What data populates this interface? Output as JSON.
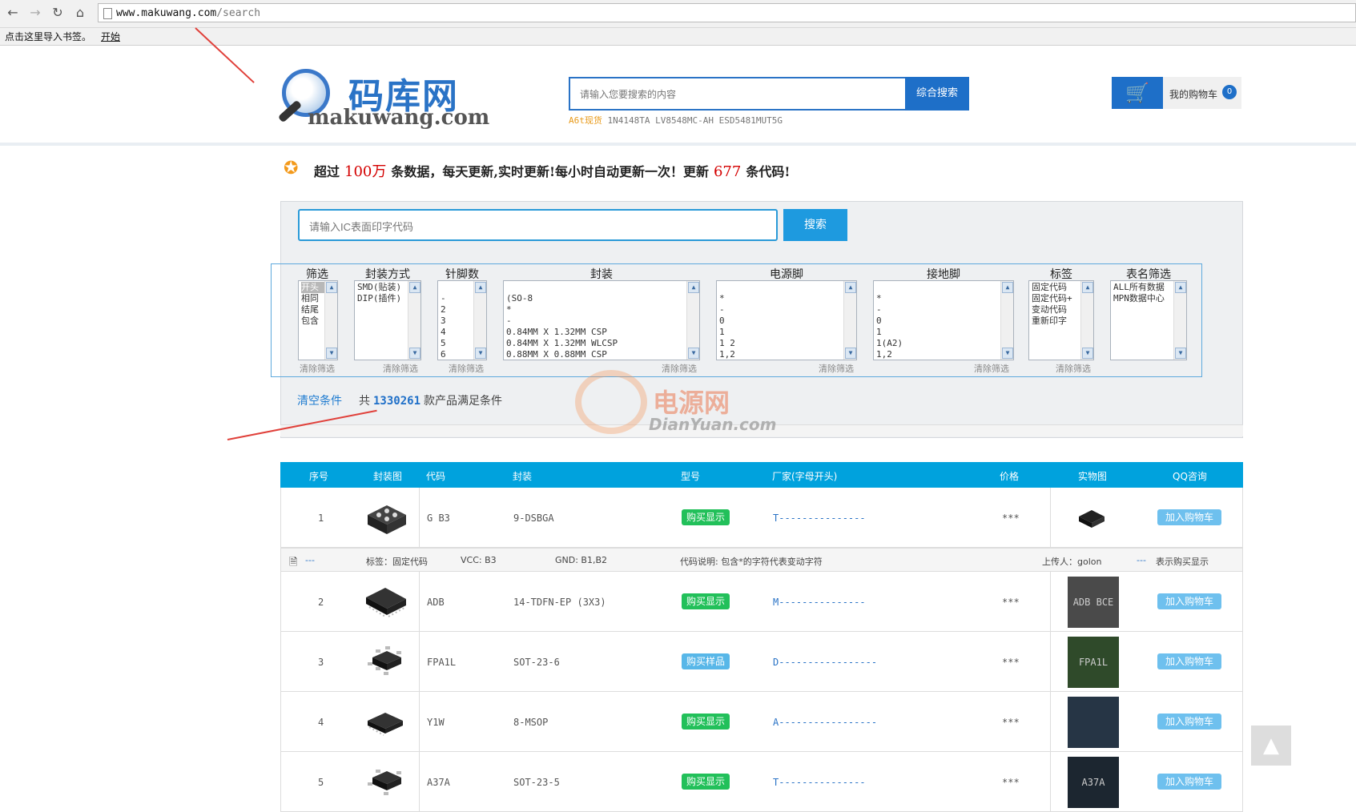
{
  "browser": {
    "url_host": "www.makuwang.com",
    "url_path": "/search",
    "bookmark_hint": "点击这里导入书签。",
    "bookmark_link": "开始"
  },
  "header": {
    "logo_cn": "码库网",
    "logo_en": "makuwang.com",
    "search_placeholder": "请输入您要搜索的内容",
    "search_button": "综合搜索",
    "hot_label": "A6t现货",
    "hot_items": "1N4148TA  LV8548MC-AH  ESD5481MUT5G",
    "cart_label": "我的购物车",
    "cart_count": "0"
  },
  "announce": {
    "p1": "超过",
    "num1": "100万",
    "p2": "条数据，每天更新,实时更新!每小时自动更新一次！更新",
    "num2": "677",
    "p3": "条代码!"
  },
  "filter": {
    "ic_placeholder": "请输入IC表面印字代码",
    "ic_button": "搜索",
    "clear_label": "清除筛选",
    "columns": [
      {
        "title": "筛选",
        "items": [
          "开头",
          "相同",
          "结尾",
          "包含"
        ]
      },
      {
        "title": "封装方式",
        "items": [
          "SMD(贴装)",
          "DIP(插件)"
        ]
      },
      {
        "title": "针脚数",
        "items": [
          "",
          "-",
          "2",
          "3",
          "4",
          "5",
          "6"
        ]
      },
      {
        "title": "封装",
        "items": [
          "",
          "(SO-8",
          "*",
          "-",
          "0.84MM X 1.32MM CSP",
          "0.84MM X 1.32MM WLCSP",
          "0.88MM X 0.88MM CSP"
        ]
      },
      {
        "title": "电源脚",
        "items": [
          "",
          "*",
          "-",
          "0",
          "1",
          "1 2",
          "1,2"
        ]
      },
      {
        "title": "接地脚",
        "items": [
          "",
          "*",
          "-",
          "0",
          "1",
          "1(A2)",
          "1,2"
        ]
      },
      {
        "title": "标签",
        "items": [
          "固定代码",
          "固定代码+",
          "变动代码",
          "重新印字"
        ]
      },
      {
        "title": "表名筛选",
        "items": [
          "ALL所有数据",
          "MPN数据中心"
        ]
      }
    ],
    "clear_all": "清空条件",
    "count_prefix": "共",
    "count_value": "1330261",
    "count_suffix": "款产品满足条件"
  },
  "watermark": {
    "cn": "电源网",
    "en": "DianYuan.com"
  },
  "table": {
    "headers": [
      "序号",
      "封装图",
      "代码",
      "封装",
      "型号",
      "厂家(字母开头)",
      "价格",
      "实物图",
      "QQ咨询"
    ],
    "cart_button": "加入购物车",
    "rows": [
      {
        "no": "1",
        "code": "G B3",
        "package": "9-DSBGA",
        "buy": "购买显示",
        "buy_color": "#22c05a",
        "mfr": "T---------------",
        "price": "***",
        "photo": ""
      },
      {
        "no": "2",
        "code": "ADB",
        "package": "14-TDFN-EP (3X3)",
        "buy": "购买显示",
        "buy_color": "#22c05a",
        "mfr": "M---------------",
        "price": "***",
        "photo": "ADB BCE"
      },
      {
        "no": "3",
        "code": "FPA1L",
        "package": "SOT-23-6",
        "buy": "购买样品",
        "buy_color": "#58b7e8",
        "mfr": "D-----------------",
        "price": "***",
        "photo": "FPA1L"
      },
      {
        "no": "4",
        "code": "Y1W",
        "package": "8-MSOP",
        "buy": "购买显示",
        "buy_color": "#22c05a",
        "mfr": "A-----------------",
        "price": "***",
        "photo": ""
      },
      {
        "no": "5",
        "code": "A37A",
        "package": "SOT-23-5",
        "buy": "购买显示",
        "buy_color": "#22c05a",
        "mfr": "T---------------",
        "price": "***",
        "photo": "A37A"
      }
    ],
    "info": {
      "dash": "---",
      "tag": "标签：固定代码",
      "vcc": "VCC: B3",
      "gnd": "GND: B1,B2",
      "desc": "代码说明: 包含*的字符代表变动字符",
      "uploader": "上传人：golon",
      "legend_dash": "---",
      "legend": "表示购买显示"
    }
  }
}
